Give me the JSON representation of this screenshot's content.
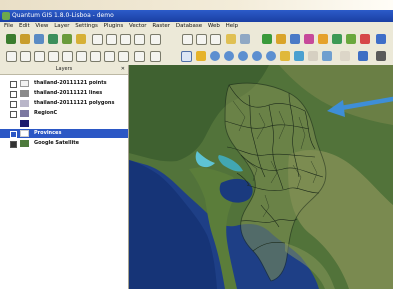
{
  "window": {
    "title": "Quantum GIS 1.8.0-Lisboa - demo"
  },
  "menu": [
    "File",
    "Edit",
    "View",
    "Layer",
    "Settings",
    "Plugins",
    "Vector",
    "Raster",
    "Database",
    "Web",
    "Help"
  ],
  "layers_panel": {
    "title": "Layers",
    "items": [
      {
        "label": "thailand-20111121 points",
        "checked": true,
        "selected": false
      },
      {
        "label": "thailand-20111121 lines",
        "checked": true,
        "selected": false
      },
      {
        "label": "thailand-20111121 polygons",
        "checked": true,
        "selected": false
      },
      {
        "label": "RegionC",
        "checked": false,
        "selected": false
      },
      {
        "label": "",
        "checked": false,
        "selected": false
      },
      {
        "label": "Provinces",
        "checked": true,
        "selected": true
      },
      {
        "label": "Google Satellite",
        "checked": true,
        "selected": false
      }
    ]
  },
  "colors": {
    "titlebar": "#1f48b2",
    "selection": "#2b57c5",
    "chrome": "#ece9d8",
    "arrow": "#3e8ed6",
    "province_line": "#1c2a1a"
  }
}
